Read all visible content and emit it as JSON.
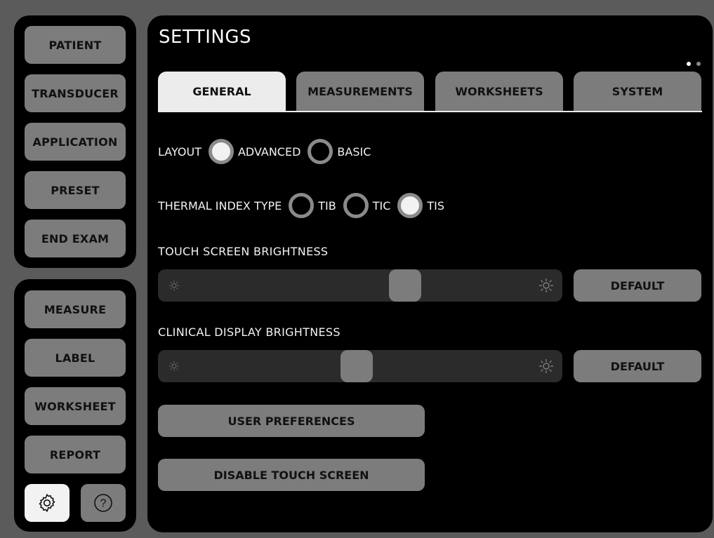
{
  "nav_top": {
    "items": [
      {
        "label": "PATIENT"
      },
      {
        "label": "TRANSDUCER"
      },
      {
        "label": "APPLICATION"
      },
      {
        "label": "PRESET"
      },
      {
        "label": "END EXAM"
      }
    ]
  },
  "nav_bottom": {
    "items": [
      {
        "label": "MEASURE"
      },
      {
        "label": "LABEL"
      },
      {
        "label": "WORKSHEET"
      },
      {
        "label": "REPORT"
      }
    ],
    "settings_icon": "gear-icon",
    "help_icon": "help-icon",
    "help_glyph": "?"
  },
  "settings": {
    "title": "SETTINGS",
    "page_indicator": {
      "current": 1,
      "total": 2
    },
    "tabs": [
      {
        "label": "GENERAL",
        "active": true
      },
      {
        "label": "MEASUREMENTS",
        "active": false
      },
      {
        "label": "WORKSHEETS",
        "active": false
      },
      {
        "label": "SYSTEM",
        "active": false
      }
    ],
    "layout": {
      "label": "LAYOUT",
      "options": [
        {
          "label": "ADVANCED",
          "checked": true
        },
        {
          "label": "BASIC",
          "checked": false
        }
      ]
    },
    "thermal_index": {
      "label": "THERMAL INDEX TYPE",
      "options": [
        {
          "label": "TIB",
          "checked": false
        },
        {
          "label": "TIC",
          "checked": false
        },
        {
          "label": "TIS",
          "checked": true
        }
      ]
    },
    "touch_brightness": {
      "label": "TOUCH SCREEN BRIGHTNESS",
      "value_fraction": 0.62,
      "default_label": "DEFAULT"
    },
    "clinical_brightness": {
      "label": "CLINICAL DISPLAY BRIGHTNESS",
      "value_fraction": 0.49,
      "default_label": "DEFAULT"
    },
    "user_preferences_label": "USER PREFERENCES",
    "disable_touch_label": "DISABLE TOUCH SCREEN"
  },
  "colors": {
    "background": "#5b5b5b",
    "panel": "#000000",
    "button": "#7c7c7c",
    "active": "#ececec"
  }
}
